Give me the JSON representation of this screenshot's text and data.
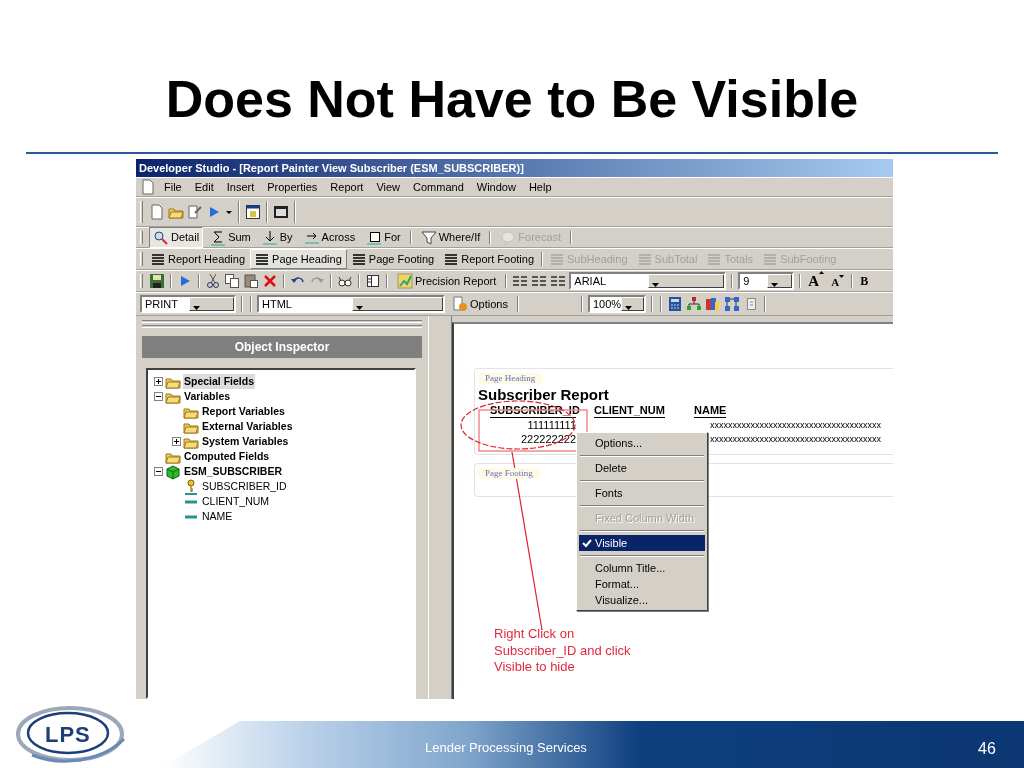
{
  "slide": {
    "title": "Does Not Have to Be Visible",
    "logo": "LPS",
    "footer": "Lender Processing Services",
    "page_number": "46"
  },
  "window": {
    "title": "Developer Studio - [Report Painter View Subscriber (ESM_SUBSCRIBER)]"
  },
  "menu": [
    "File",
    "Edit",
    "Insert",
    "Properties",
    "Report",
    "View",
    "Command",
    "Window",
    "Help"
  ],
  "report_toolbar": [
    {
      "kind": "detail",
      "label": "Detail",
      "selected": true,
      "disabled": false
    },
    {
      "kind": "sum",
      "label": "Sum",
      "selected": false,
      "disabled": false
    },
    {
      "kind": "by",
      "label": "By",
      "selected": false,
      "disabled": false
    },
    {
      "kind": "across",
      "label": "Across",
      "selected": false,
      "disabled": false
    },
    {
      "kind": "for",
      "label": "For",
      "selected": false,
      "disabled": false
    },
    {
      "kind": "where",
      "label": "Where/If",
      "selected": false,
      "disabled": false
    },
    {
      "kind": "forecast",
      "label": "Forecast",
      "selected": false,
      "disabled": true
    }
  ],
  "sections": [
    {
      "label": "Report Heading",
      "selected": false,
      "disabled": false
    },
    {
      "label": "Page Heading",
      "selected": true,
      "disabled": false
    },
    {
      "label": "Page Footing",
      "selected": false,
      "disabled": false
    },
    {
      "label": "Report Footing",
      "selected": false,
      "disabled": false
    },
    {
      "label": "SubHeading",
      "selected": false,
      "disabled": true
    },
    {
      "label": "SubTotal",
      "selected": false,
      "disabled": true
    },
    {
      "label": "Totals",
      "selected": false,
      "disabled": true
    },
    {
      "label": "SubFooting",
      "selected": false,
      "disabled": true
    }
  ],
  "edit_toolbar": {
    "precision_report": "Precision Report",
    "font": "ARIAL",
    "size": "9",
    "grow_font": "A",
    "shrink_font": "A",
    "bold": "B"
  },
  "output_toolbar": {
    "output": "PRINT",
    "format": "HTML",
    "options": "Options",
    "zoom": "100%"
  },
  "object_inspector": {
    "title": "Object Inspector",
    "tree": [
      {
        "kind": "folder",
        "label": "Special Fields",
        "selected": true,
        "expanded": false
      },
      {
        "kind": "folder",
        "label": "Variables",
        "selected": false,
        "expanded": true,
        "children": [
          {
            "kind": "folder",
            "label": "Report Variables",
            "selected": false
          },
          {
            "kind": "folder",
            "label": "External Variables",
            "selected": false
          },
          {
            "kind": "folder",
            "label": "System Variables",
            "selected": false,
            "expanded": false
          }
        ]
      },
      {
        "kind": "folder",
        "label": "Computed Fields",
        "selected": false
      },
      {
        "kind": "table",
        "label": "ESM_SUBSCRIBER",
        "selected": false,
        "expanded": true,
        "children": [
          {
            "kind": "key",
            "label": "SUBSCRIBER_ID",
            "selected": false
          },
          {
            "kind": "field",
            "label": "CLIENT_NUM",
            "selected": false
          },
          {
            "kind": "field",
            "label": "NAME",
            "selected": false
          }
        ]
      }
    ]
  },
  "report": {
    "page_heading_label": "Page Heading",
    "title": "Subscriber Report",
    "columns": [
      "SUBSCRIBER_ID",
      "CLIENT_NUM",
      "NAME"
    ],
    "rows": [
      {
        "subscriber_id": "111111111",
        "name": "xxxxxxxxxxxxxxxxxxxxxxxxxxxxxxxxxxxxxx"
      },
      {
        "subscriber_id": "222222222",
        "name": "xxxxxxxxxxxxxxxxxxxxxxxxxxxxxxxxxxxxxx"
      }
    ],
    "page_footing_label": "Page Footing"
  },
  "context_menu": [
    {
      "label": "Options...",
      "selected": false,
      "disabled": false,
      "checked": false,
      "separator_after": true
    },
    {
      "label": "Delete",
      "selected": false,
      "disabled": false,
      "checked": false,
      "separator_after": true
    },
    {
      "label": "Fonts",
      "selected": false,
      "disabled": false,
      "checked": false,
      "separator_after": true
    },
    {
      "label": "Fixed Column Width",
      "selected": false,
      "disabled": true,
      "checked": false,
      "separator_after": true
    },
    {
      "label": "Visible",
      "selected": true,
      "disabled": false,
      "checked": true,
      "separator_after": true
    },
    {
      "label": "Column Title...",
      "selected": false,
      "disabled": false,
      "checked": false,
      "separator_after": false
    },
    {
      "label": "Format...",
      "selected": false,
      "disabled": false,
      "checked": false,
      "separator_after": false
    },
    {
      "label": "Visualize...",
      "selected": false,
      "disabled": false,
      "checked": false,
      "separator_after": false
    }
  ],
  "annotation": "Right Click on\nSubscriber_ID and click\nVisible to hide"
}
